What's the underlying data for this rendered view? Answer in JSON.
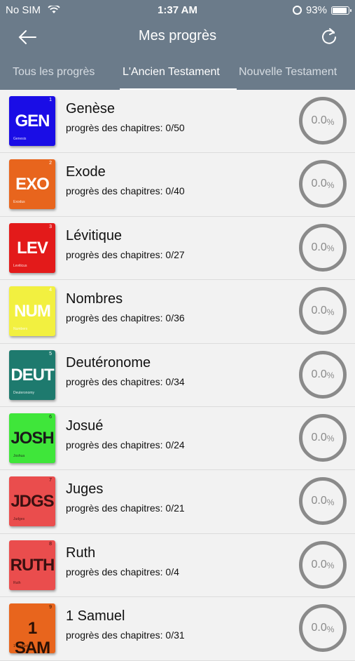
{
  "status": {
    "carrier": "No SIM",
    "time": "1:37 AM",
    "battery": "93%",
    "battery_level": 0.93
  },
  "header": {
    "title": "Mes progrès",
    "back_icon": "arrow-left-icon",
    "refresh_icon": "refresh-icon"
  },
  "tabs": [
    {
      "label": "Tous les progrès",
      "active": false
    },
    {
      "label": "L'Ancien Testament",
      "active": true
    },
    {
      "label": "Nouvelle Testament",
      "active": false
    }
  ],
  "books": [
    {
      "name": "Genèse",
      "progress": "progrès des chapitres: 0/50",
      "percent": "0.0",
      "unit": "%",
      "abbr": "GEN",
      "sub": "Genesis",
      "num": "1",
      "bg": "#1a0de6",
      "fg": "#ffffff"
    },
    {
      "name": "Exode",
      "progress": "progrès des chapitres: 0/40",
      "percent": "0.0",
      "unit": "%",
      "abbr": "EXO",
      "sub": "Exodus",
      "num": "2",
      "bg": "#e8651d",
      "fg": "#ffffff"
    },
    {
      "name": "Lévitique",
      "progress": "progrès des chapitres: 0/27",
      "percent": "0.0",
      "unit": "%",
      "abbr": "LEV",
      "sub": "Leviticus",
      "num": "3",
      "bg": "#e31a1a",
      "fg": "#ffffff"
    },
    {
      "name": "Nombres",
      "progress": "progrès des chapitres: 0/36",
      "percent": "0.0",
      "unit": "%",
      "abbr": "NUM",
      "sub": "Numbers",
      "num": "4",
      "bg": "#f2f040",
      "fg": "#ffffff"
    },
    {
      "name": "Deutéronome",
      "progress": "progrès des chapitres: 0/34",
      "percent": "0.0",
      "unit": "%",
      "abbr": "DEUT",
      "sub": "Deuteronomy",
      "num": "5",
      "bg": "#1e7a6e",
      "fg": "#ffffff"
    },
    {
      "name": "Josué",
      "progress": "progrès des chapitres: 0/24",
      "percent": "0.0",
      "unit": "%",
      "abbr": "JOSH",
      "sub": "Joshua",
      "num": "6",
      "bg": "#3fe63a",
      "fg": "#1a1a1a"
    },
    {
      "name": "Juges",
      "progress": "progrès des chapitres: 0/21",
      "percent": "0.0",
      "unit": "%",
      "abbr": "JDGS",
      "sub": "Judges",
      "num": "7",
      "bg": "#ea4d4d",
      "fg": "#3a1010"
    },
    {
      "name": "Ruth",
      "progress": "progrès des chapitres: 0/4",
      "percent": "0.0",
      "unit": "%",
      "abbr": "RUTH",
      "sub": "Ruth",
      "num": "8",
      "bg": "#ea4d4d",
      "fg": "#3a1010"
    },
    {
      "name": "1 Samuel",
      "progress": "progrès des chapitres: 0/31",
      "percent": "0.0",
      "unit": "%",
      "abbr": "1 SAM",
      "sub": "1 Samuel",
      "num": "9",
      "bg": "#e8651d",
      "fg": "#2a1005"
    }
  ]
}
